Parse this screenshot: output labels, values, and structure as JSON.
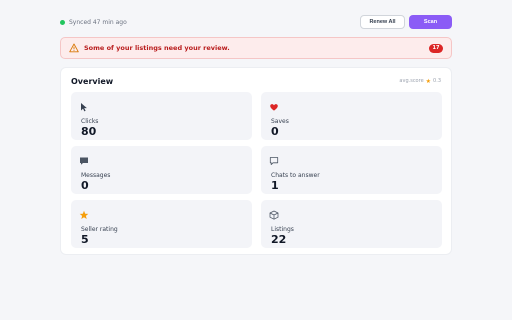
{
  "header": {
    "sync_text": "Synced 47 min ago",
    "renew_all_label": "Renew All",
    "scan_label": "Scan"
  },
  "alert": {
    "message": "Some of your listings need your review.",
    "count": "17"
  },
  "overview": {
    "title": "Overview",
    "avg_label": "avg.score",
    "avg_value": "0.3",
    "stats": [
      {
        "label": "Clicks",
        "value": "80",
        "icon": "cursor-icon"
      },
      {
        "label": "Saves",
        "value": "0",
        "icon": "heart-icon"
      },
      {
        "label": "Messages",
        "value": "0",
        "icon": "message-icon"
      },
      {
        "label": "Chats to answer",
        "value": "1",
        "icon": "chat-bubble-icon"
      },
      {
        "label": "Seller rating",
        "value": "5",
        "icon": "star-icon"
      },
      {
        "label": "Listings",
        "value": "22",
        "icon": "box-icon"
      }
    ]
  },
  "colors": {
    "accent": "#8b5cf6",
    "alert_text": "#b91c1c",
    "alert_bg": "#fdecec",
    "sync_dot": "#22c55e",
    "star": "#f59e0b",
    "heart": "#dc2626"
  }
}
